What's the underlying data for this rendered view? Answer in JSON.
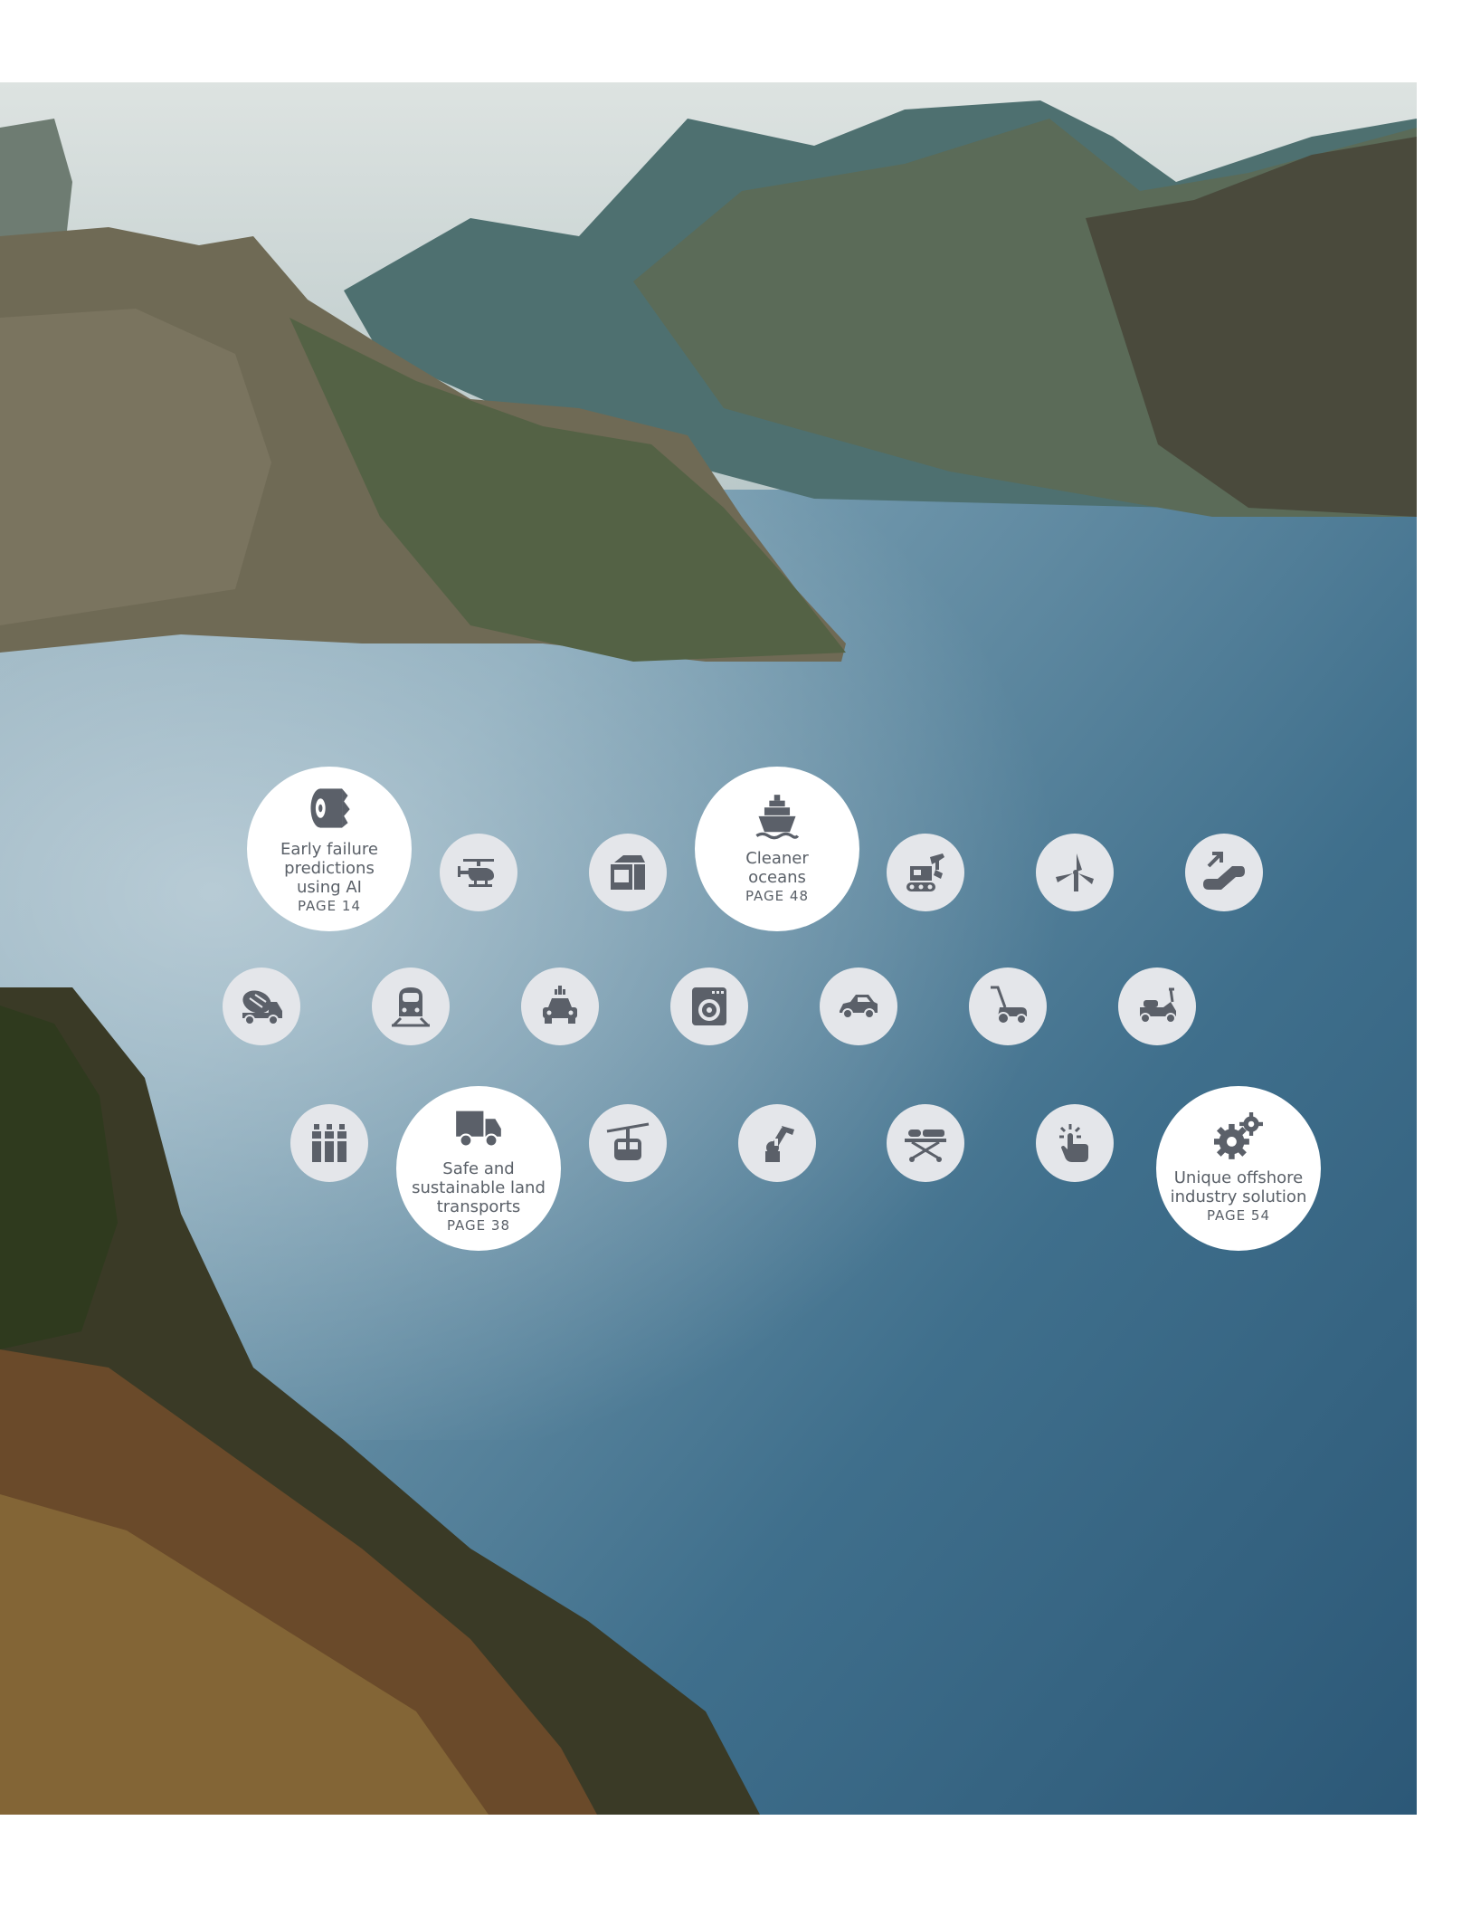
{
  "highlights": [
    {
      "id": "failure",
      "lines": [
        "Early failure",
        "predictions",
        "using AI"
      ],
      "page": "PAGE 14",
      "icon": "paper-roll-icon"
    },
    {
      "id": "oceans",
      "lines": [
        "Cleaner",
        "oceans"
      ],
      "page": "PAGE 48",
      "icon": "ship-icon"
    },
    {
      "id": "transports",
      "lines": [
        "Safe and",
        "sustainable land",
        "transports"
      ],
      "page": "PAGE 38",
      "icon": "truck-icon"
    },
    {
      "id": "offshore",
      "lines": [
        "Unique offshore",
        "industry solution"
      ],
      "page": "PAGE 54",
      "icon": "gears-icon"
    }
  ],
  "icons": [
    "helicopter-icon",
    "parcel-icon",
    "excavator-icon",
    "wind-turbine-icon",
    "escalator-icon",
    "cement-mixer-icon",
    "train-icon",
    "electric-car-icon",
    "washing-machine-icon",
    "car-icon",
    "lawn-mower-icon",
    "scooter-icon",
    "bottles-icon",
    "cable-car-icon",
    "robot-arm-icon",
    "stretcher-icon",
    "touch-icon"
  ],
  "colors": {
    "icon": "#5b6069",
    "small_bubble": "#e4e6ea",
    "big_bubble": "#ffffff"
  }
}
